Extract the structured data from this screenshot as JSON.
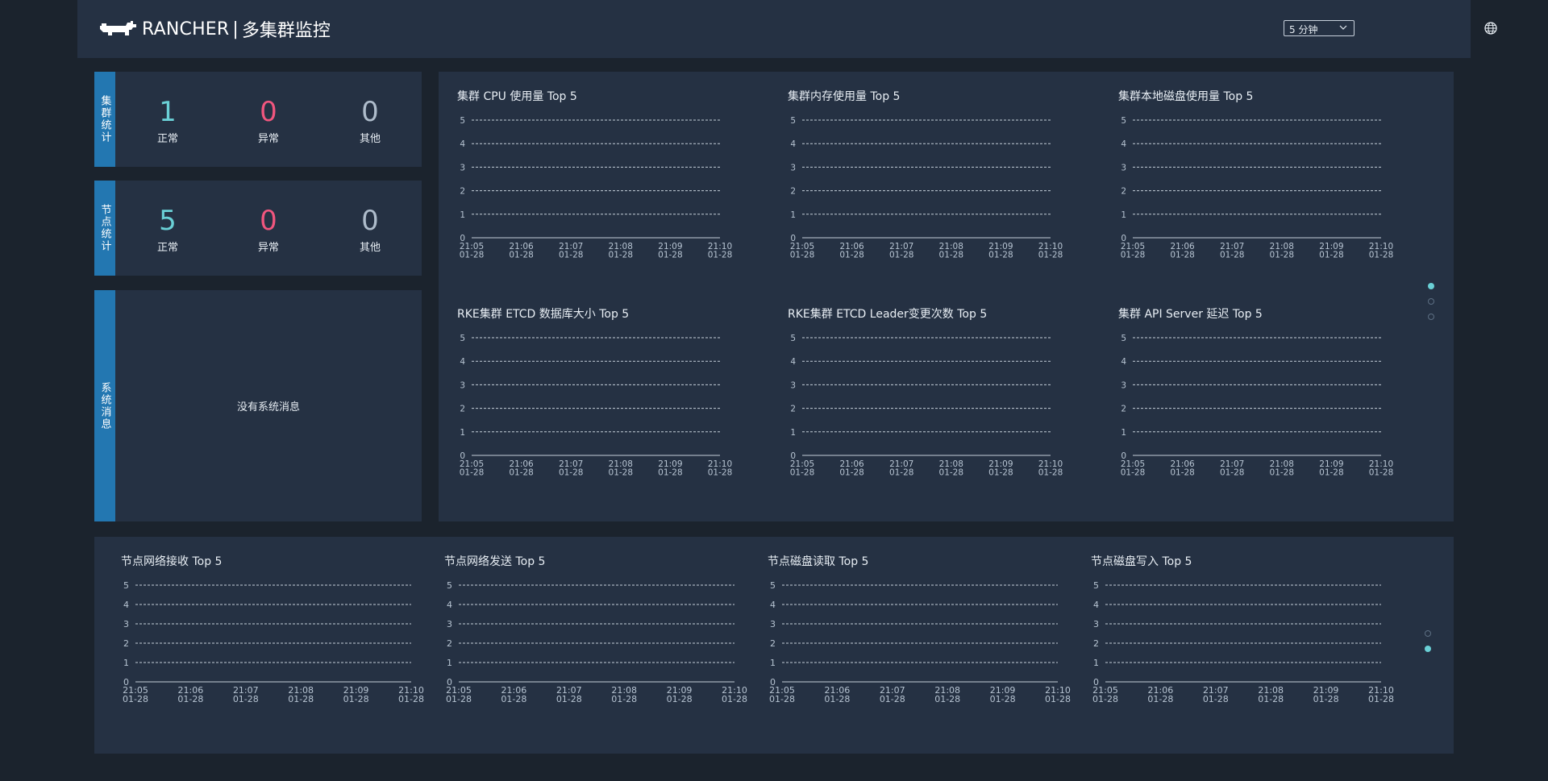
{
  "header": {
    "brand_name": "RANCHER",
    "separator": "|",
    "title": "多集群监控",
    "time_range": "5 分钟",
    "logo_icon": "rancher-logo-icon",
    "language_icon": "globe-icon"
  },
  "colors": {
    "normal": "#6ad0d6",
    "abnormal": "#f0567e",
    "other": "#aebccb",
    "tab": "#2377b1"
  },
  "cluster_stats": {
    "tab_label": "集群统计",
    "normal_value": "1",
    "normal_label": "正常",
    "abnormal_value": "0",
    "abnormal_label": "异常",
    "other_value": "0",
    "other_label": "其他"
  },
  "node_stats": {
    "tab_label": "节点统计",
    "normal_value": "5",
    "normal_label": "正常",
    "abnormal_value": "0",
    "abnormal_label": "异常",
    "other_value": "0",
    "other_label": "其他"
  },
  "system_messages": {
    "tab_label": "系统消息",
    "empty_text": "没有系统消息"
  },
  "chart_data": [
    {
      "id": "c1",
      "type": "line",
      "title": "集群 CPU 使用量 Top 5",
      "y_ticks": [
        "0",
        "1",
        "2",
        "3",
        "4",
        "5"
      ],
      "ylim": [
        0,
        5
      ],
      "categories": [
        "21:05\n01-28",
        "21:06\n01-28",
        "21:07\n01-28",
        "21:08\n01-28",
        "21:09\n01-28",
        "21:10\n01-28"
      ],
      "series": []
    },
    {
      "id": "c2",
      "type": "line",
      "title": "集群内存使用量 Top 5",
      "y_ticks": [
        "0",
        "1",
        "2",
        "3",
        "4",
        "5"
      ],
      "ylim": [
        0,
        5
      ],
      "categories": [
        "21:05\n01-28",
        "21:06\n01-28",
        "21:07\n01-28",
        "21:08\n01-28",
        "21:09\n01-28",
        "21:10\n01-28"
      ],
      "series": []
    },
    {
      "id": "c3",
      "type": "line",
      "title": "集群本地磁盘使用量 Top 5",
      "y_ticks": [
        "0",
        "1",
        "2",
        "3",
        "4",
        "5"
      ],
      "ylim": [
        0,
        5
      ],
      "categories": [
        "21:05\n01-28",
        "21:06\n01-28",
        "21:07\n01-28",
        "21:08\n01-28",
        "21:09\n01-28",
        "21:10\n01-28"
      ],
      "series": []
    },
    {
      "id": "c4",
      "type": "line",
      "title": "RKE集群 ETCD 数据库大小 Top 5",
      "y_ticks": [
        "0",
        "1",
        "2",
        "3",
        "4",
        "5"
      ],
      "ylim": [
        0,
        5
      ],
      "categories": [
        "21:05\n01-28",
        "21:06\n01-28",
        "21:07\n01-28",
        "21:08\n01-28",
        "21:09\n01-28",
        "21:10\n01-28"
      ],
      "series": []
    },
    {
      "id": "c5",
      "type": "line",
      "title": "RKE集群 ETCD Leader变更次数 Top 5",
      "y_ticks": [
        "0",
        "1",
        "2",
        "3",
        "4",
        "5"
      ],
      "ylim": [
        0,
        5
      ],
      "categories": [
        "21:05\n01-28",
        "21:06\n01-28",
        "21:07\n01-28",
        "21:08\n01-28",
        "21:09\n01-28",
        "21:10\n01-28"
      ],
      "series": []
    },
    {
      "id": "c6",
      "type": "line",
      "title": "集群 API Server 延迟 Top 5",
      "y_ticks": [
        "0",
        "1",
        "2",
        "3",
        "4",
        "5"
      ],
      "ylim": [
        0,
        5
      ],
      "categories": [
        "21:05\n01-28",
        "21:06\n01-28",
        "21:07\n01-28",
        "21:08\n01-28",
        "21:09\n01-28",
        "21:10\n01-28"
      ],
      "series": []
    },
    {
      "id": "c7",
      "type": "line",
      "title": "节点网络接收 Top 5",
      "y_ticks": [
        "0",
        "1",
        "2",
        "3",
        "4",
        "5"
      ],
      "ylim": [
        0,
        5
      ],
      "categories": [
        "21:05\n01-28",
        "21:06\n01-28",
        "21:07\n01-28",
        "21:08\n01-28",
        "21:09\n01-28",
        "21:10\n01-28"
      ],
      "series": []
    },
    {
      "id": "c8",
      "type": "line",
      "title": "节点网络发送 Top 5",
      "y_ticks": [
        "0",
        "1",
        "2",
        "3",
        "4",
        "5"
      ],
      "ylim": [
        0,
        5
      ],
      "categories": [
        "21:05\n01-28",
        "21:06\n01-28",
        "21:07\n01-28",
        "21:08\n01-28",
        "21:09\n01-28",
        "21:10\n01-28"
      ],
      "series": []
    },
    {
      "id": "c9",
      "type": "line",
      "title": "节点磁盘读取 Top 5",
      "y_ticks": [
        "0",
        "1",
        "2",
        "3",
        "4",
        "5"
      ],
      "ylim": [
        0,
        5
      ],
      "categories": [
        "21:05\n01-28",
        "21:06\n01-28",
        "21:07\n01-28",
        "21:08\n01-28",
        "21:09\n01-28",
        "21:10\n01-28"
      ],
      "series": []
    },
    {
      "id": "c10",
      "type": "line",
      "title": "节点磁盘写入 Top 5",
      "y_ticks": [
        "0",
        "1",
        "2",
        "3",
        "4",
        "5"
      ],
      "ylim": [
        0,
        5
      ],
      "categories": [
        "21:05\n01-28",
        "21:06\n01-28",
        "21:07\n01-28",
        "21:08\n01-28",
        "21:09\n01-28",
        "21:10\n01-28"
      ],
      "series": []
    }
  ],
  "pagers": {
    "top_active_page": 1,
    "top_page_count": 3,
    "bottom_active_page": 2,
    "bottom_page_count": 2
  }
}
